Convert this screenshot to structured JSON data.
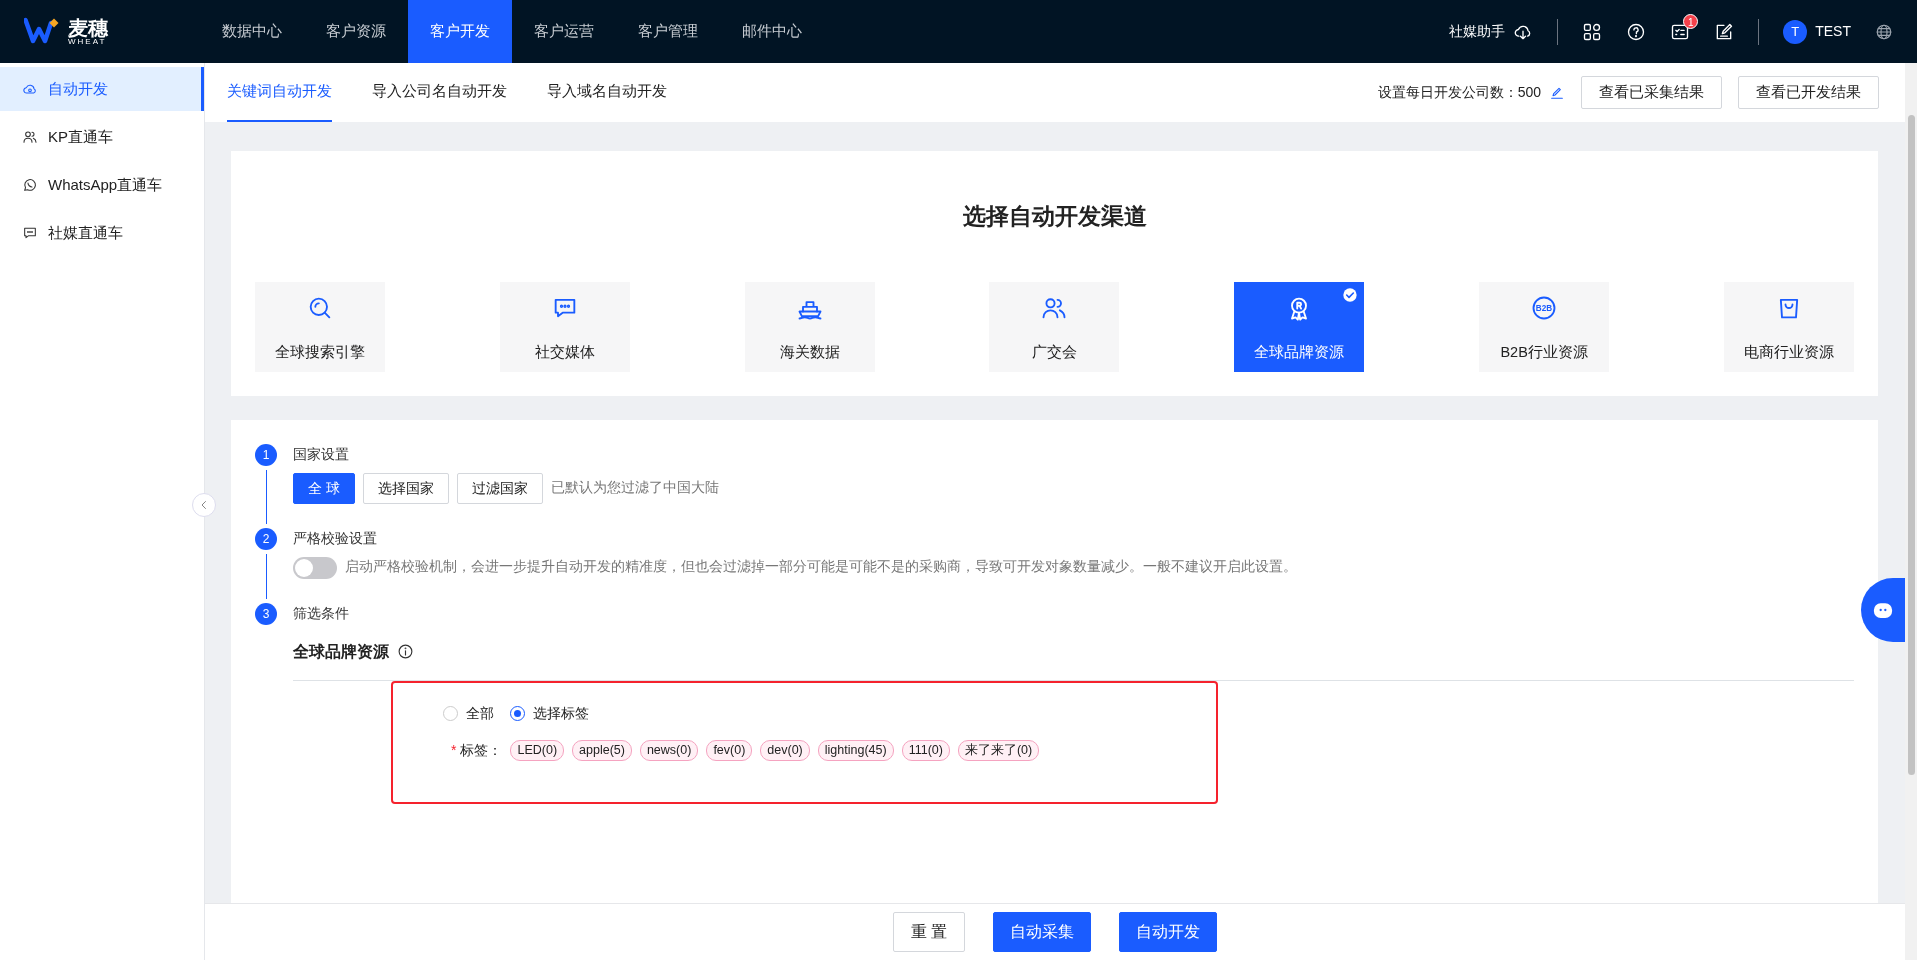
{
  "header": {
    "logo": {
      "text": "麦穗",
      "sub": "WHEAT"
    },
    "nav": [
      {
        "label": "数据中心",
        "selected": false
      },
      {
        "label": "客户资源",
        "selected": false
      },
      {
        "label": "客户开发",
        "selected": true
      },
      {
        "label": "客户运营",
        "selected": false
      },
      {
        "label": "客户管理",
        "selected": false
      },
      {
        "label": "邮件中心",
        "selected": false
      }
    ],
    "assistant": "社媒助手",
    "task_badge": "1",
    "user": {
      "initial": "T",
      "name": "TEST"
    }
  },
  "sidebar": {
    "items": [
      {
        "label": "自动开发",
        "kind": "cloud",
        "selected": true
      },
      {
        "label": "KP直通车",
        "kind": "people",
        "selected": false
      },
      {
        "label": "WhatsApp直通车",
        "kind": "whatsapp",
        "selected": false
      },
      {
        "label": "社媒直通车",
        "kind": "chat",
        "selected": false
      }
    ]
  },
  "tabs": [
    {
      "label": "关键词自动开发",
      "selected": true
    },
    {
      "label": "导入公司名自动开发",
      "selected": false
    },
    {
      "label": "导入域名自动开发",
      "selected": false
    }
  ],
  "daily_limit": {
    "label": "设置每日开发公司数：",
    "value": "500"
  },
  "actions": [
    "查看已采集结果",
    "查看已开发结果"
  ],
  "channels": {
    "title": "选择自动开发渠道",
    "items": [
      {
        "label": "全球搜索引擎",
        "kind": "search",
        "selected": false
      },
      {
        "label": "社交媒体",
        "kind": "chat",
        "selected": false
      },
      {
        "label": "海关数据",
        "kind": "ship",
        "selected": false
      },
      {
        "label": "广交会",
        "kind": "people",
        "selected": false
      },
      {
        "label": "全球品牌资源",
        "kind": "medal",
        "selected": true
      },
      {
        "label": "B2B行业资源",
        "kind": "b2b",
        "icon_text": "B2B",
        "selected": false
      },
      {
        "label": "电商行业资源",
        "kind": "bag",
        "selected": false
      }
    ]
  },
  "steps": [
    {
      "number": "1",
      "title": "国家设置",
      "kind": "buttons",
      "options": [
        {
          "label": "全 球",
          "selected": true
        },
        {
          "label": "选择国家",
          "selected": false
        },
        {
          "label": "过滤国家",
          "selected": false
        }
      ],
      "hint": "已默认为您过滤了中国大陆"
    },
    {
      "number": "2",
      "title": "严格校验设置",
      "kind": "switch",
      "on": false,
      "text": "启动严格校验机制，会进一步提升自动开发的精准度，但也会过滤掉一部分可能是可能不是的采购商，导致可开发对象数量减少。一般不建议开启此设置。"
    },
    {
      "number": "3",
      "title": "筛选条件",
      "kind": "filter"
    }
  ],
  "filter": {
    "heading": "全球品牌资源",
    "radios": [
      {
        "label": "全部",
        "selected": false
      },
      {
        "label": "选择标签",
        "selected": true
      }
    ],
    "required_mark": "*",
    "tags_label": "标签：",
    "tags": [
      "LED(0)",
      "apple(5)",
      "news(0)",
      "fev(0)",
      "dev(0)",
      "lighting(45)",
      "111(0)",
      "来了来了(0)"
    ]
  },
  "footer": [
    {
      "label": "重 置",
      "kind": "outline"
    },
    {
      "label": "自动采集",
      "kind": "primary"
    },
    {
      "label": "自动开发",
      "kind": "primary"
    }
  ]
}
